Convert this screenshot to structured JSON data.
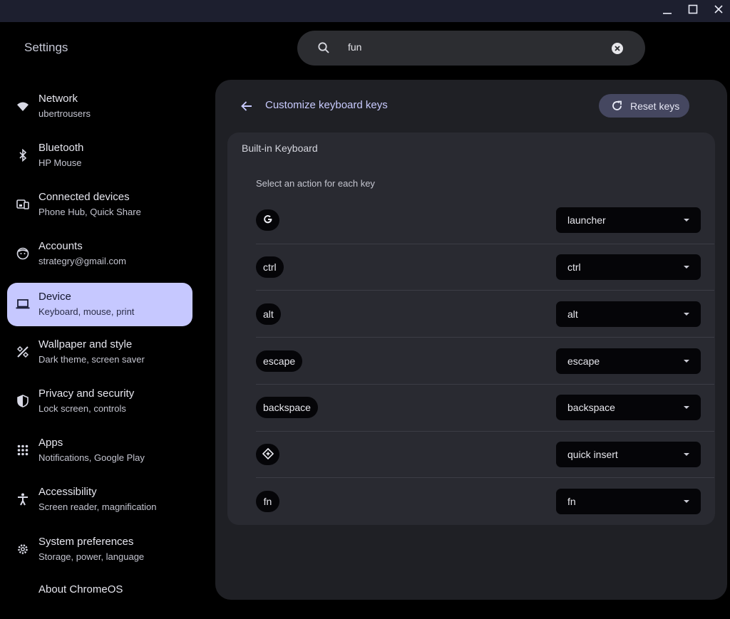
{
  "window": {
    "minimize_icon": "minimize-icon",
    "maximize_icon": "maximize-icon",
    "close_icon": "close-icon"
  },
  "app": {
    "title": "Settings"
  },
  "search": {
    "value": "fun",
    "icon": "search-icon",
    "clear_icon": "clear-icon"
  },
  "sidebar": {
    "items": [
      {
        "title": "Network",
        "subtitle": "ubertrousers",
        "icon": "wifi-icon"
      },
      {
        "title": "Bluetooth",
        "subtitle": "HP Mouse",
        "icon": "bluetooth-icon"
      },
      {
        "title": "Connected devices",
        "subtitle": "Phone Hub, Quick Share",
        "icon": "connected-devices-icon"
      },
      {
        "title": "Accounts",
        "subtitle": "strategry@gmail.com",
        "icon": "account-icon"
      },
      {
        "title": "Device",
        "subtitle": "Keyboard, mouse, print",
        "icon": "laptop-icon",
        "active": true
      },
      {
        "title": "Wallpaper and style",
        "subtitle": "Dark theme, screen saver",
        "icon": "paint-icon"
      },
      {
        "title": "Privacy and security",
        "subtitle": "Lock screen, controls",
        "icon": "shield-icon"
      },
      {
        "title": "Apps",
        "subtitle": "Notifications, Google Play",
        "icon": "apps-grid-icon"
      },
      {
        "title": "Accessibility",
        "subtitle": "Screen reader, magnification",
        "icon": "accessibility-icon"
      },
      {
        "title": "System preferences",
        "subtitle": "Storage, power, language",
        "icon": "gear-icon"
      },
      {
        "title": "About ChromeOS",
        "subtitle": "",
        "icon": ""
      }
    ]
  },
  "page": {
    "title": "Customize keyboard keys",
    "back_icon": "back-arrow-icon",
    "reset_label": "Reset keys",
    "reset_icon": "refresh-icon"
  },
  "keyboard": {
    "title": "Built-in Keyboard",
    "subtitle": "Select an action for each key",
    "rows": [
      {
        "key": "G",
        "key_type": "icon",
        "key_icon": "google-g-icon",
        "action": "launcher"
      },
      {
        "key": "ctrl",
        "key_type": "text",
        "action": "ctrl"
      },
      {
        "key": "alt",
        "key_type": "text",
        "action": "alt"
      },
      {
        "key": "escape",
        "key_type": "text",
        "action": "escape"
      },
      {
        "key": "backspace",
        "key_type": "text",
        "action": "backspace"
      },
      {
        "key": "",
        "key_type": "icon",
        "key_icon": "quick-insert-icon",
        "action": "quick insert"
      },
      {
        "key": "fn",
        "key_type": "text",
        "action": "fn"
      }
    ]
  },
  "colors": {
    "accent": "#c6c8ff",
    "titlebar": "#1d1f2f",
    "panel": "#1f2025",
    "card": "#292a31",
    "reset_button": "#454760"
  }
}
